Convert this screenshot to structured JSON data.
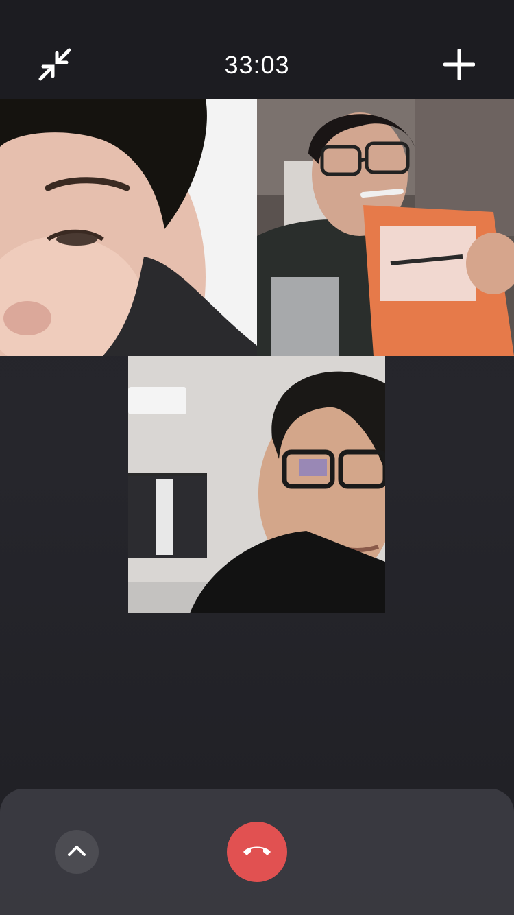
{
  "call": {
    "timer": "33:03",
    "accent_color": "#e15151"
  },
  "toolbar": {
    "minimize_icon": "minimize-arrows-icon",
    "add_icon": "plus-icon"
  },
  "participants": [
    {
      "tile": "participant-video-1"
    },
    {
      "tile": "participant-video-2"
    },
    {
      "tile": "participant-video-3"
    }
  ],
  "controls": {
    "expand_icon": "chevron-up-icon",
    "hangup_icon": "phone-hangup-icon",
    "hangup_color": "#e15151"
  }
}
